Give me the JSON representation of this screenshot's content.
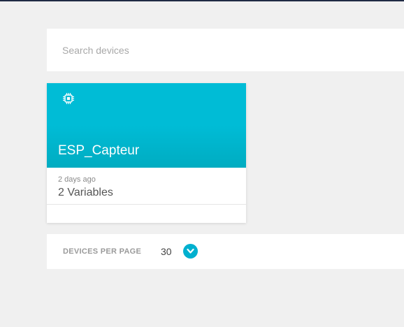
{
  "colors": {
    "page_background": "#f0f0f0",
    "card_accent": "#00bcd6",
    "toggle_accent": "#00b0cf"
  },
  "search": {
    "placeholder": "Search devices",
    "value": ""
  },
  "devices": [
    {
      "name": "ESP_Capteur",
      "icon": "chip-icon",
      "last_activity": "2 days ago",
      "variables": "2 Variables"
    }
  ],
  "pagination": {
    "label": "DEVICES PER PAGE",
    "value": "30",
    "toggle_icon": "chevron-down-icon"
  }
}
